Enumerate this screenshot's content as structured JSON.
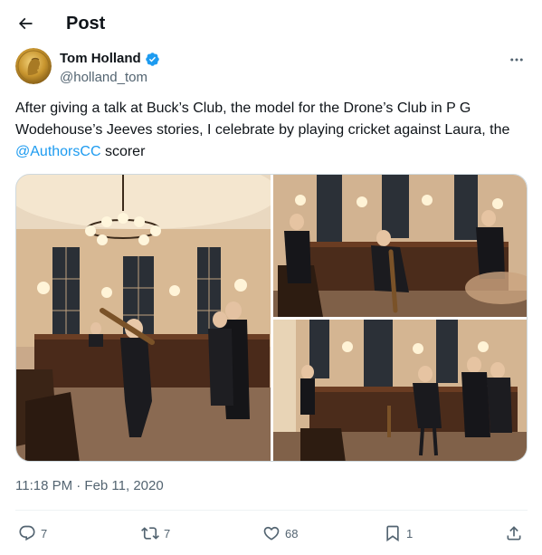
{
  "header": {
    "title": "Post"
  },
  "author": {
    "display_name": "Tom Holland",
    "handle": "@holland_tom",
    "verified": true
  },
  "tweet": {
    "text_before_mention": "After giving a talk at Buck’s Club, the model for the Drone’s Club in P G Wodehouse’s Jeeves stories, I celebrate by playing cricket against Laura, the ",
    "mention": "@AuthorsCC",
    "text_after_mention": " scorer"
  },
  "media": {
    "photo_count": 3
  },
  "meta": {
    "timestamp": "11:18 PM · Feb 11, 2020"
  },
  "actions": {
    "reply_count": "7",
    "repost_count": "7",
    "like_count": "68",
    "bookmark_count": "1"
  },
  "colors": {
    "accent": "#1d9bf0",
    "text": "#0f1419",
    "secondary": "#536471",
    "verified_badge": "#1d9bf0"
  },
  "icons": [
    "back-arrow-icon",
    "verified-badge-icon",
    "more-icon",
    "reply-icon",
    "repost-icon",
    "like-icon",
    "bookmark-icon",
    "share-icon"
  ]
}
